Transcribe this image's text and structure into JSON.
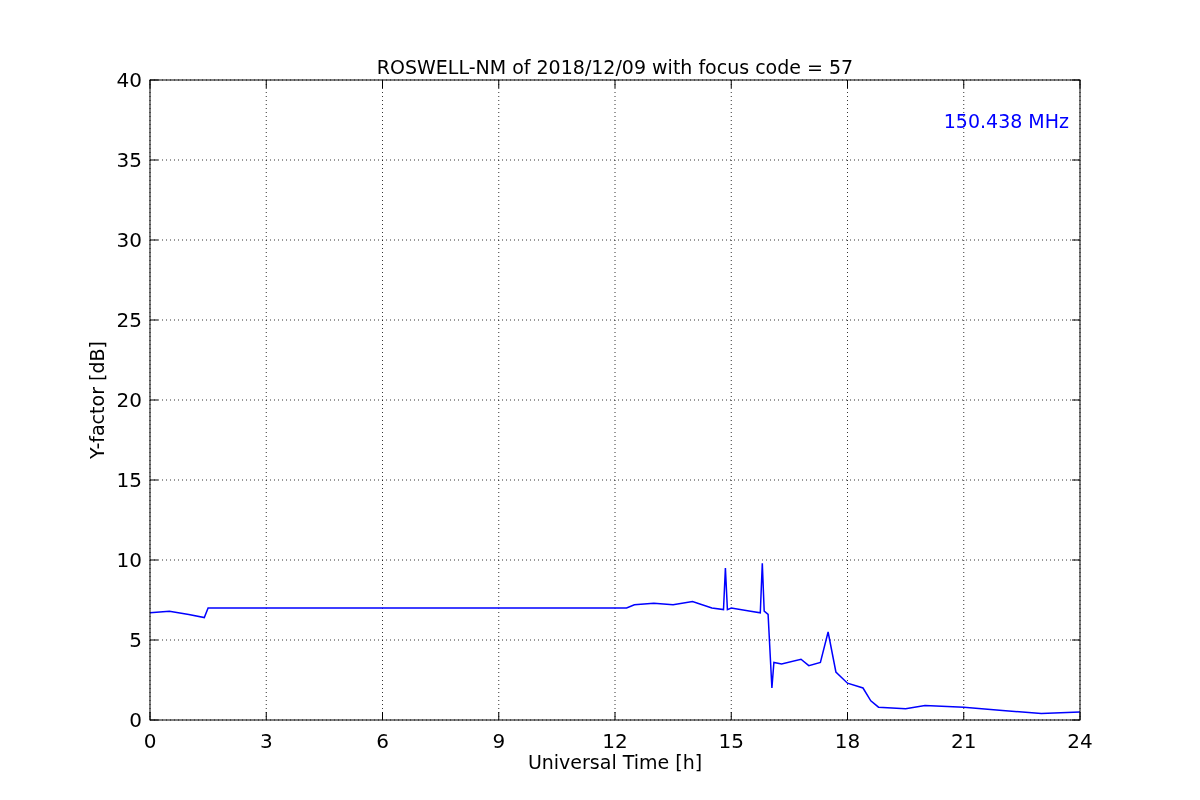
{
  "chart_data": {
    "type": "line",
    "title": "ROSWELL-NM of 2018/12/09 with focus code = 57",
    "xlabel": "Universal Time [h]",
    "ylabel": "Y-factor [dB]",
    "x": [
      0,
      0.5,
      1,
      1.4,
      1.5,
      12.3,
      12.5,
      13,
      13.5,
      14,
      14.5,
      14.8,
      14.85,
      14.9,
      15,
      15.5,
      15.75,
      15.8,
      15.85,
      15.95,
      16.05,
      16.1,
      16.3,
      16.8,
      17,
      17.3,
      17.5,
      17.7,
      18,
      18.4,
      18.6,
      18.8,
      19.5,
      20,
      21,
      22,
      23,
      24
    ],
    "series": [
      {
        "name": "150.438 MHz",
        "color": "#0000ff",
        "values": [
          6.7,
          6.8,
          6.6,
          6.4,
          7.0,
          7.0,
          7.2,
          7.3,
          7.2,
          7.4,
          7.0,
          6.9,
          9.5,
          6.9,
          7.0,
          6.8,
          6.7,
          9.8,
          6.8,
          6.6,
          2.0,
          3.6,
          3.5,
          3.8,
          3.4,
          3.6,
          5.5,
          3.0,
          2.3,
          2.0,
          1.2,
          0.8,
          0.7,
          0.9,
          0.8,
          0.6,
          0.4,
          0.5
        ]
      }
    ],
    "xlim": [
      0,
      24
    ],
    "ylim": [
      0,
      40
    ],
    "xticks": [
      0,
      3,
      6,
      9,
      12,
      15,
      18,
      21,
      24
    ],
    "yticks": [
      0,
      5,
      10,
      15,
      20,
      25,
      30,
      35,
      40
    ],
    "grid": true
  }
}
